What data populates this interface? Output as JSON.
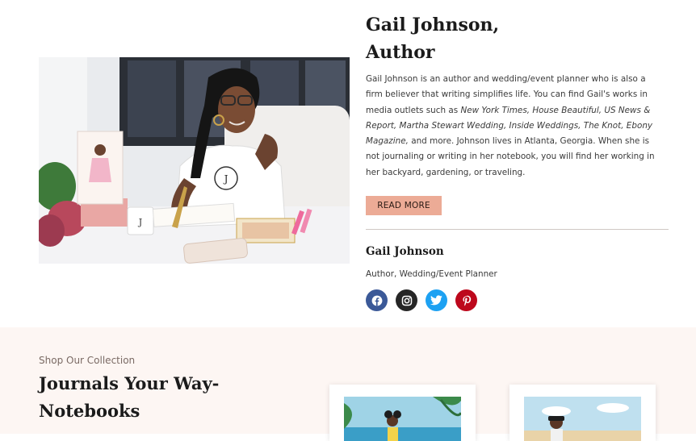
{
  "author": {
    "title_line1": "Gail Johnson,",
    "title_line2": "Author",
    "bio": {
      "p1": "Gail Johnson is an author and wedding/event planner who is also a firm believer that writing simplifies life. You can find Gail's works in media outlets such as ",
      "outlets": "New York Times, House Beautiful, US News & Report, Martha Stewart Wedding, Inside Weddings, The Knot, Ebony Magazine,",
      "p2": " and more. Johnson lives in Atlanta, Georgia. When she is not journaling or writing in her notebook, you will find her working in her backyard, gardening, or traveling."
    },
    "read_more_label": "READ MORE",
    "name": "Gail Johnson",
    "role": "Author, Wedding/Event Planner",
    "photo_icon": "author-photo",
    "mug_letter": "J",
    "social": [
      {
        "icon": "facebook-icon",
        "color": "#3b5998"
      },
      {
        "icon": "instagram-icon",
        "color": "#262626"
      },
      {
        "icon": "twitter-icon",
        "color": "#1da1f2"
      },
      {
        "icon": "pinterest-icon",
        "color": "#bd081c"
      }
    ]
  },
  "collection": {
    "eyebrow": "Shop Our Collection",
    "heading_line1": "Journals Your Way-",
    "heading_line2": "Notebooks"
  },
  "colors": {
    "accent": "#ecab96",
    "section_bg": "#fdf6f3"
  }
}
